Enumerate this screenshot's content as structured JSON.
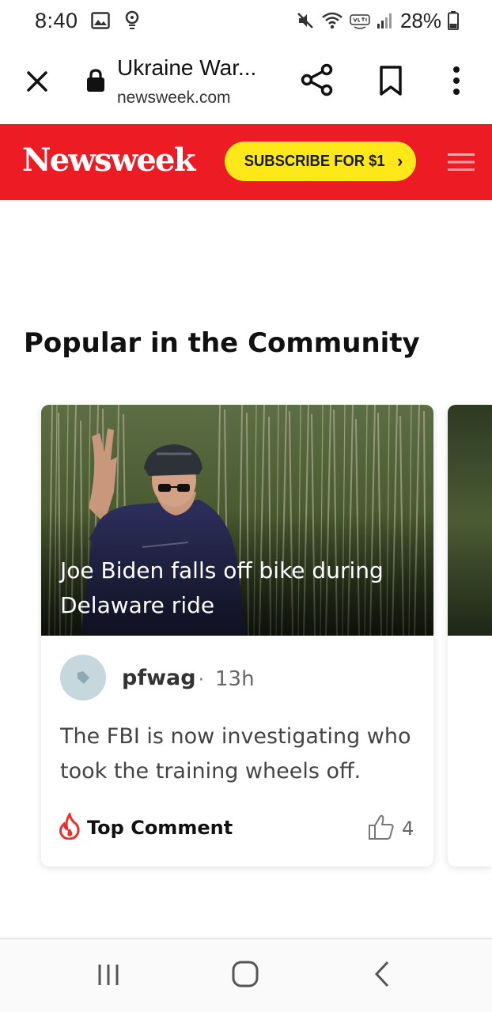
{
  "status_bar": {
    "time": "8:40",
    "battery": "28%"
  },
  "browser": {
    "page_title": "Ukraine War...",
    "domain": "newsweek.com"
  },
  "site_header": {
    "logo": "Newsweek",
    "subscribe_label": "SUBSCRIBE FOR $1",
    "subscribe_chevron": "›",
    "brand_color": "#ed1c24",
    "subscribe_color": "#ffe81a"
  },
  "main": {
    "section_title": "Popular in the Community",
    "card": {
      "headline": "Joe Biden falls off bike during Delaware ride",
      "comment": {
        "user": "pfwag",
        "separator": "·",
        "time": "13h",
        "text": "The FBI is now investigating who took the training wheels off.",
        "badge": "Top Comment",
        "likes": "4"
      }
    }
  },
  "icons": {
    "status": [
      "image-icon",
      "location-pin-icon",
      "mute-icon",
      "wifi-icon",
      "volte-icon",
      "signal-icon",
      "battery-icon"
    ],
    "browser": [
      "close-icon",
      "lock-icon",
      "share-icon",
      "bookmark-icon",
      "more-vert-icon"
    ],
    "nav": [
      "recent-apps-icon",
      "home-icon",
      "back-icon"
    ]
  }
}
